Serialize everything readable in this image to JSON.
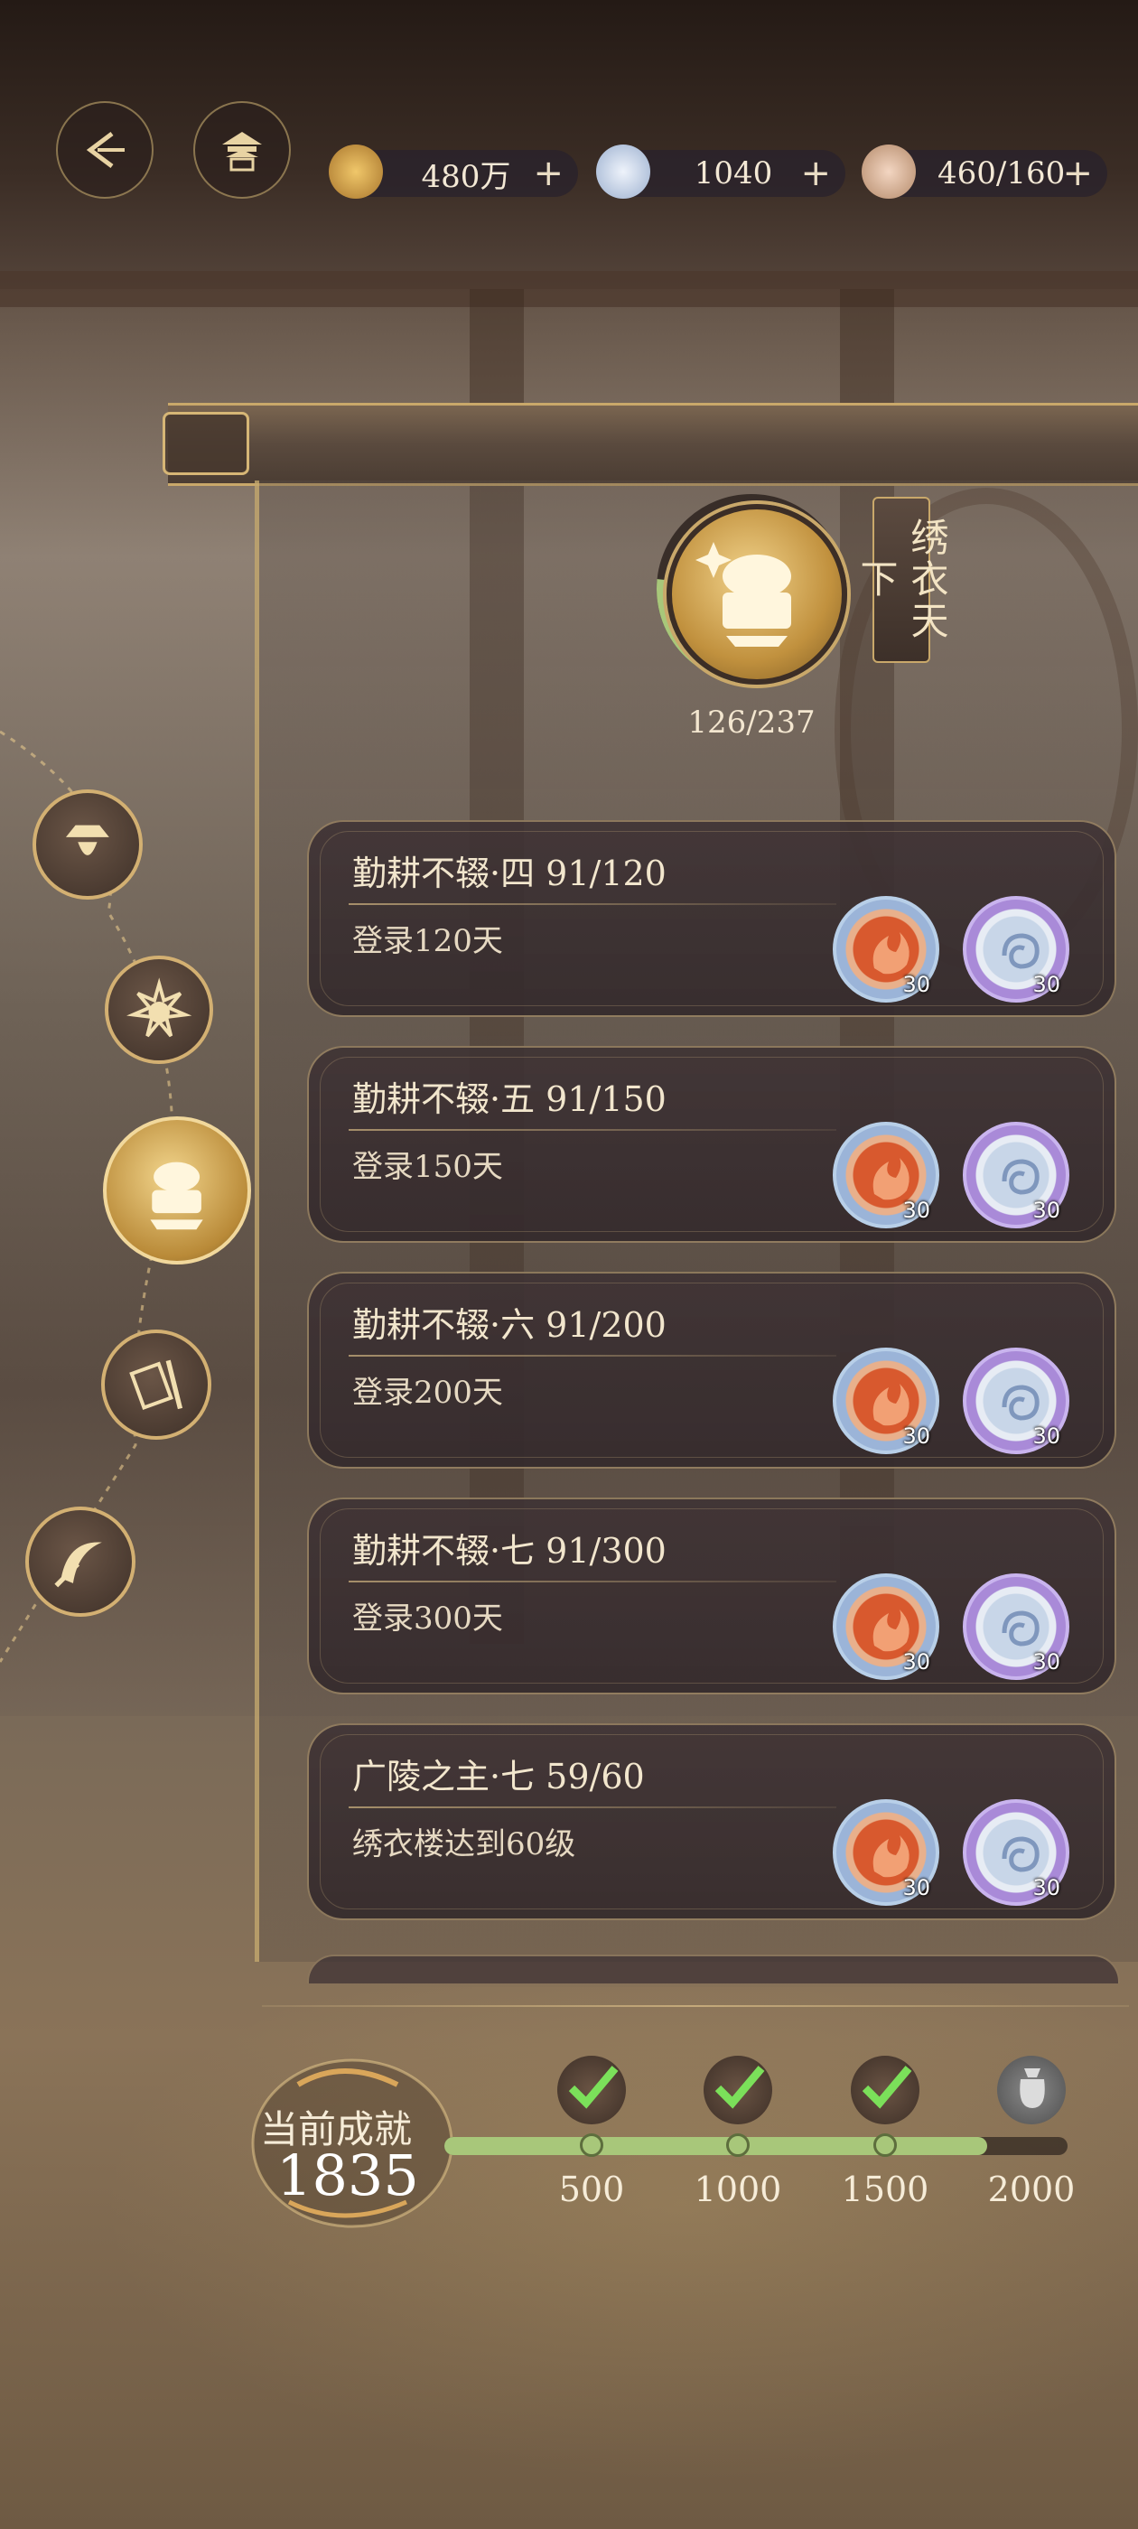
{
  "resources": [
    {
      "name": "copper-coin",
      "value": "480万",
      "color": "#d2a24a"
    },
    {
      "name": "jade-orb",
      "value": "1040",
      "color": "#c6d3e6"
    },
    {
      "name": "food-bowl",
      "value": "460/160",
      "color": "#e8c4a6"
    }
  ],
  "title_badge": {
    "title": "绣衣天下",
    "progress_text": "126/237",
    "progress_fraction": 0.53
  },
  "tasks": [
    {
      "title": "勤耕不辍·四 91/120",
      "desc": "登录120天",
      "rewards": [
        {
          "icon": "fire-token-icon",
          "count": "30"
        },
        {
          "icon": "jade-token-icon",
          "count": "30"
        }
      ]
    },
    {
      "title": "勤耕不辍·五 91/150",
      "desc": "登录150天",
      "rewards": [
        {
          "icon": "fire-token-icon",
          "count": "30"
        },
        {
          "icon": "jade-token-icon",
          "count": "30"
        }
      ]
    },
    {
      "title": "勤耕不辍·六 91/200",
      "desc": "登录200天",
      "rewards": [
        {
          "icon": "fire-token-icon",
          "count": "30"
        },
        {
          "icon": "jade-token-icon",
          "count": "30"
        }
      ]
    },
    {
      "title": "勤耕不辍·七 91/300",
      "desc": "登录300天",
      "rewards": [
        {
          "icon": "fire-token-icon",
          "count": "30"
        },
        {
          "icon": "jade-token-icon",
          "count": "30"
        }
      ]
    },
    {
      "title": "广陵之主·七 59/60",
      "desc": "绣衣楼达到60级",
      "rewards": [
        {
          "icon": "fire-token-icon",
          "count": "30"
        },
        {
          "icon": "jade-token-icon",
          "count": "30"
        }
      ]
    }
  ],
  "achievement": {
    "label": "当前成就",
    "value": "1835",
    "max": 2000,
    "milestones": [
      {
        "label": "500",
        "value": 500,
        "claimed": true
      },
      {
        "label": "1000",
        "value": 1000,
        "claimed": true
      },
      {
        "label": "1500",
        "value": 1500,
        "claimed": true
      },
      {
        "label": "2000",
        "value": 2000,
        "claimed": false
      }
    ]
  },
  "colors": {
    "accent_gold": "#d3b072",
    "progress_green": "#a8c77a",
    "card_bg": "#3e3234"
  }
}
